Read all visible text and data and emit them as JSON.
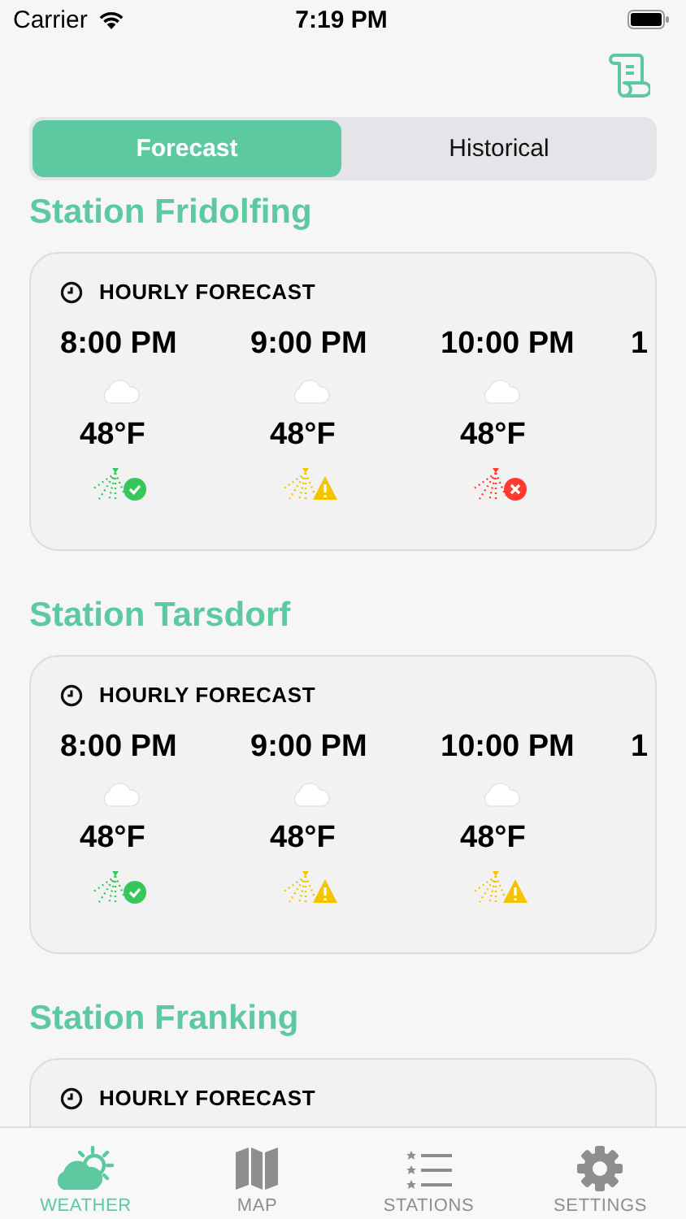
{
  "status_bar": {
    "carrier": "Carrier",
    "time": "7:19 PM"
  },
  "segments": [
    {
      "label": "Forecast",
      "selected": true
    },
    {
      "label": "Historical",
      "selected": false
    }
  ],
  "stations": [
    {
      "name": "Station Fridolfing",
      "section_title": "HOURLY FORECAST",
      "hours": [
        {
          "time": "8:00 PM",
          "temp": "48°F",
          "kind": "ok"
        },
        {
          "time": "9:00 PM",
          "temp": "48°F",
          "kind": "warning"
        },
        {
          "time": "10:00 PM",
          "temp": "48°F",
          "kind": "error"
        },
        {
          "time": "1"
        }
      ]
    },
    {
      "name": "Station Tarsdorf",
      "section_title": "HOURLY FORECAST",
      "hours": [
        {
          "time": "8:00 PM",
          "temp": "48°F",
          "kind": "ok"
        },
        {
          "time": "9:00 PM",
          "temp": "48°F",
          "kind": "warning"
        },
        {
          "time": "10:00 PM",
          "temp": "48°F",
          "kind": "warning"
        },
        {
          "time": "1"
        }
      ]
    },
    {
      "name": "Station Franking",
      "section_title": "HOURLY FORECAST"
    }
  ],
  "tab_bar": [
    {
      "label": "WEATHER",
      "kind": "weather",
      "selected": true
    },
    {
      "label": "MAP",
      "kind": "map",
      "selected": false
    },
    {
      "label": "STATIONS",
      "kind": "stations",
      "selected": false
    },
    {
      "label": "SETTINGS",
      "kind": "settings",
      "selected": false
    }
  ]
}
